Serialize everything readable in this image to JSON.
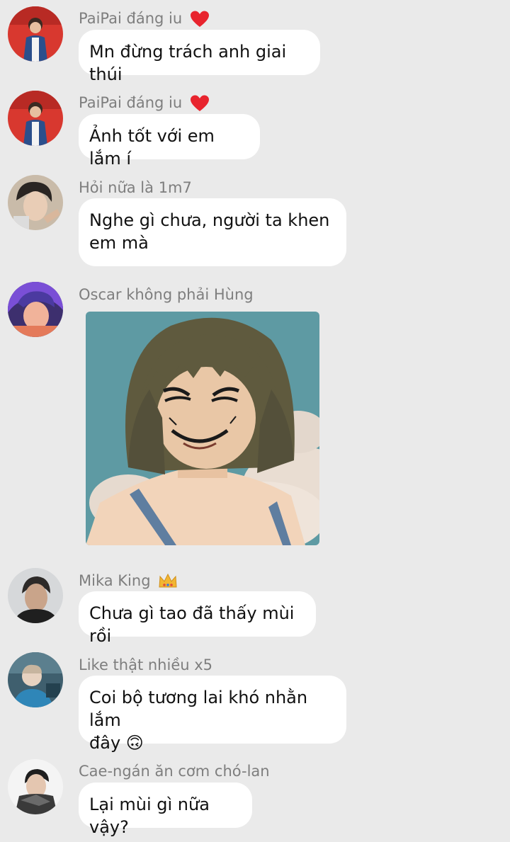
{
  "chat": {
    "messages": [
      {
        "sender": "PaiPai đáng iu",
        "badge": "heart",
        "text": "Mn đừng trách anh giai thúi"
      },
      {
        "sender": "PaiPai đáng iu",
        "badge": "heart",
        "text": "Ảnh tốt với em lắm í"
      },
      {
        "sender": "Hỏi nữa là 1m7",
        "text_line1": "Nghe gì chưa, người ta khen",
        "text_line2": "em mà"
      },
      {
        "sender": "Oscar không phải Hùng",
        "image": "anime-girl-bob-haircut-smiling-sticker"
      },
      {
        "sender": "Mika King",
        "badge": "crown",
        "text": "Chưa gì tao đã thấy mùi rồi"
      },
      {
        "sender": "Like thật nhiều x5",
        "text_line1": "Coi bộ tương lai khó nhằn lắm",
        "text_line2": "đây",
        "emoji": "🙃"
      },
      {
        "sender": "Cae-ngán ăn cơm chó-lan",
        "text": "Lại mùi gì nữa vậy?"
      }
    ]
  },
  "colors": {
    "background": "#eaeaea",
    "bubble": "#ffffff",
    "sender_name": "#7e7e7e",
    "message_text": "#111111",
    "heart": "#e8242e",
    "crown": "#f2b632"
  }
}
